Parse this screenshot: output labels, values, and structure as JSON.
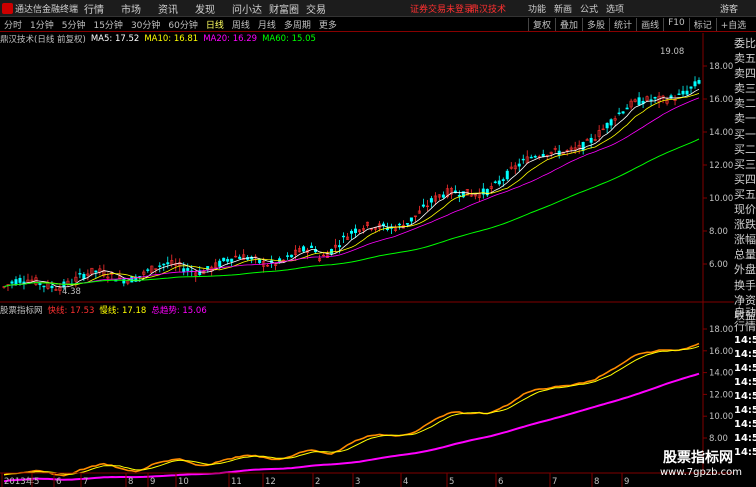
{
  "app": {
    "title": "通达信金融终端"
  },
  "menu": [
    "行情",
    "市场",
    "资讯",
    "发现",
    "问小达",
    "财富圈",
    "交易"
  ],
  "notice": {
    "text1": "证券交易未登录",
    "text2": "鼎汉技术"
  },
  "right_menu": [
    "功能",
    "新画",
    "公式",
    "选项"
  ],
  "guest": "游客",
  "periods": [
    "分时",
    "1分钟",
    "5分钟",
    "15分钟",
    "30分钟",
    "60分钟",
    "日线",
    "周线",
    "月线",
    "多周期",
    "更多"
  ],
  "active_period": "日线",
  "tools": [
    "复权",
    "叠加",
    "多股",
    "统计",
    "画线",
    "F10",
    "标记",
    "+自选"
  ],
  "main_head": {
    "name": "鼎汉技术(日线 前复权)",
    "ma5": "MA5: 17.52",
    "ma10": "MA10: 16.81",
    "ma20": "MA20: 16.29",
    "ma60": "MA60: 15.05"
  },
  "sub_head": {
    "name": "股票指标网",
    "fast": "快线: 17.53",
    "slow": "慢线: 17.18",
    "trend": "总趋势: 15.06"
  },
  "annotations": {
    "high": "19.08",
    "low": "4.38"
  },
  "y_ticks_main": [
    "18.00",
    "16.00",
    "14.00",
    "12.00",
    "10.00",
    "8.00",
    "6.00"
  ],
  "y_ticks_sub": [
    "18.00",
    "16.00",
    "14.00",
    "12.00",
    "10.00",
    "8.00"
  ],
  "x_ticks": [
    "2013年",
    "5",
    "6",
    "7",
    "8",
    "9",
    "10",
    "11",
    "12",
    "2",
    "3",
    "4",
    "5",
    "6",
    "7",
    "8",
    "9"
  ],
  "side_list": [
    "委比",
    "卖五",
    "卖四",
    "卖三",
    "卖二",
    "卖一",
    "买一",
    "买二",
    "买三",
    "买四",
    "买五",
    "现价",
    "涨跌",
    "涨幅",
    "总量",
    "外盘",
    "换手",
    "净资",
    "收益"
  ],
  "side_sub": [
    "自动",
    "行情",
    "14:50",
    "14:50",
    "14:50",
    "14:50",
    "14:50",
    "14:50",
    "14:50",
    "14:50",
    "14:50"
  ],
  "watermark": {
    "line1": "股票指标网",
    "line2": "www.7gpzb.com"
  },
  "colors": {
    "up": "#ff3030",
    "down": "#00ffff",
    "ma5": "#ffffff",
    "ma10": "#ffff00",
    "ma20": "#ff00ff",
    "ma60": "#00ff00",
    "axis": "#800000",
    "fast": "#ff8c00",
    "slow": "#ffff00",
    "trend": "#ff00ff"
  }
}
